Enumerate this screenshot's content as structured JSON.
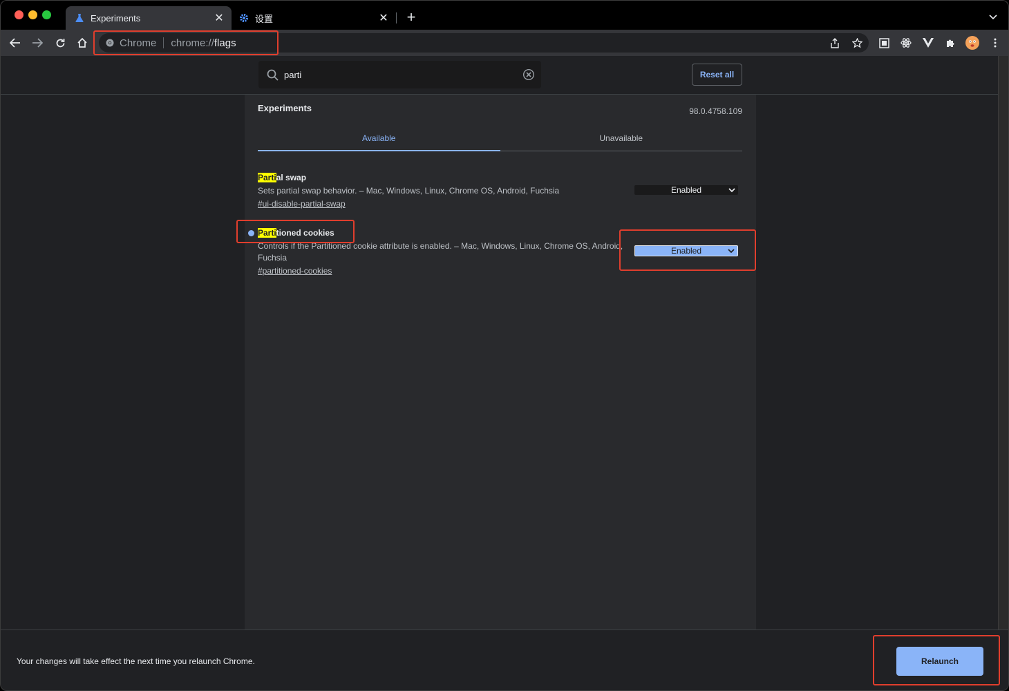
{
  "tabs": [
    {
      "title": "Experiments",
      "icon": "flask-icon",
      "active": true
    },
    {
      "title": "设置",
      "icon": "gear-icon",
      "active": false
    }
  ],
  "omnibox": {
    "site_label": "Chrome",
    "url_scheme": "chrome://",
    "url_path": "flags"
  },
  "header": {
    "search_value": "parti",
    "reset_label": "Reset all"
  },
  "page": {
    "title": "Experiments",
    "version": "98.0.4758.109",
    "tabs": [
      {
        "label": "Available",
        "selected": true
      },
      {
        "label": "Unavailable",
        "selected": false
      }
    ]
  },
  "flags": [
    {
      "name_highlight": "Parti",
      "name_rest": "al swap",
      "description": "Sets partial swap behavior. – Mac, Windows, Linux, Chrome OS, Android, Fuchsia",
      "link": "#ui-disable-partial-swap",
      "value": "Enabled",
      "modified": false
    },
    {
      "name_highlight": "Parti",
      "name_rest": "tioned cookies",
      "description": "Controls if the Partitioned cookie attribute is enabled. – Mac, Windows, Linux, Chrome OS, Android, Fuchsia",
      "link": "#partitioned-cookies",
      "value": "Enabled",
      "modified": true
    }
  ],
  "bottom": {
    "message": "Your changes will take effect the next time you relaunch Chrome.",
    "relaunch_label": "Relaunch"
  },
  "colors": {
    "accent": "#8ab4f8",
    "highlight": "#ffff00",
    "annotation": "#e03e2d"
  }
}
